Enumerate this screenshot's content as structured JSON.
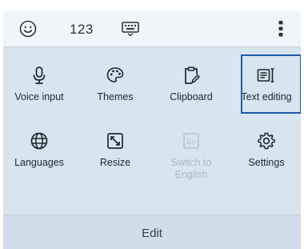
{
  "topbar": {
    "emoji_icon": "smiley-face-icon",
    "number_label": "123",
    "keyboard_icon": "keyboard-icon",
    "more_icon": "more-vertical-icon"
  },
  "menu": {
    "items": [
      {
        "label": "Voice input",
        "icon": "microphone-icon",
        "enabled": true
      },
      {
        "label": "Themes",
        "icon": "palette-icon",
        "enabled": true
      },
      {
        "label": "Clipboard",
        "icon": "clipboard-icon",
        "enabled": true
      },
      {
        "label": "Text editing",
        "icon": "text-cursor-icon",
        "enabled": true,
        "selected": true
      },
      {
        "label": "Languages",
        "icon": "globe-icon",
        "enabled": true
      },
      {
        "label": "Resize",
        "icon": "resize-icon",
        "enabled": true
      },
      {
        "label": "Switch to\nEnglish",
        "icon": "english-switch-icon",
        "enabled": false
      },
      {
        "label": "Settings",
        "icon": "gear-icon",
        "enabled": true
      }
    ]
  },
  "bottom": {
    "label": "Edit"
  },
  "colors": {
    "panel": "#d7e5ef",
    "selection_border": "#1f5aa6",
    "disabled_text": "#a9b8c3"
  }
}
